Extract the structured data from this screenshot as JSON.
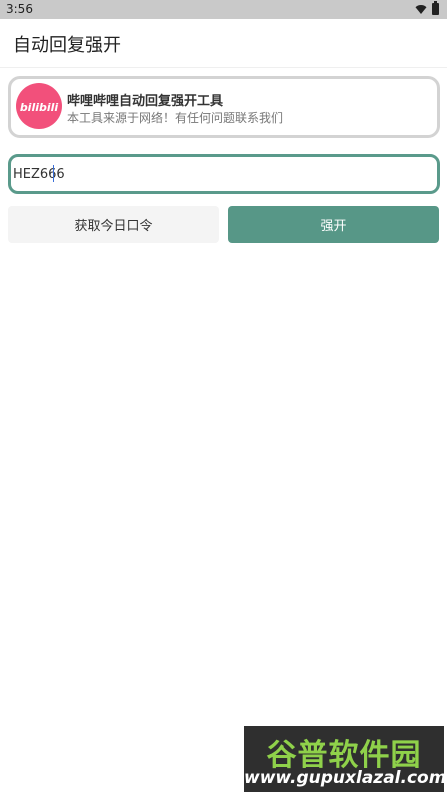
{
  "status_bar": {
    "time": "3:56",
    "icons": [
      "wifi-icon",
      "battery-icon"
    ]
  },
  "app_bar": {
    "title": "自动回复强开"
  },
  "info_card": {
    "logo_text": "bilibili",
    "title": "哔哩哔哩自动回复强开工具",
    "subtitle": "本工具来源于网络！有任何问题联系我们",
    "logo_color": "#f2507b"
  },
  "code_input": {
    "value": "HEZ666",
    "border_color": "#5a9a8b"
  },
  "buttons": {
    "get_code_label": "获取今日口令",
    "open_label": "强开",
    "accent": "#579787"
  },
  "watermark": {
    "top": "谷普软件园",
    "bottom": "www.gupuxlazal.com"
  }
}
